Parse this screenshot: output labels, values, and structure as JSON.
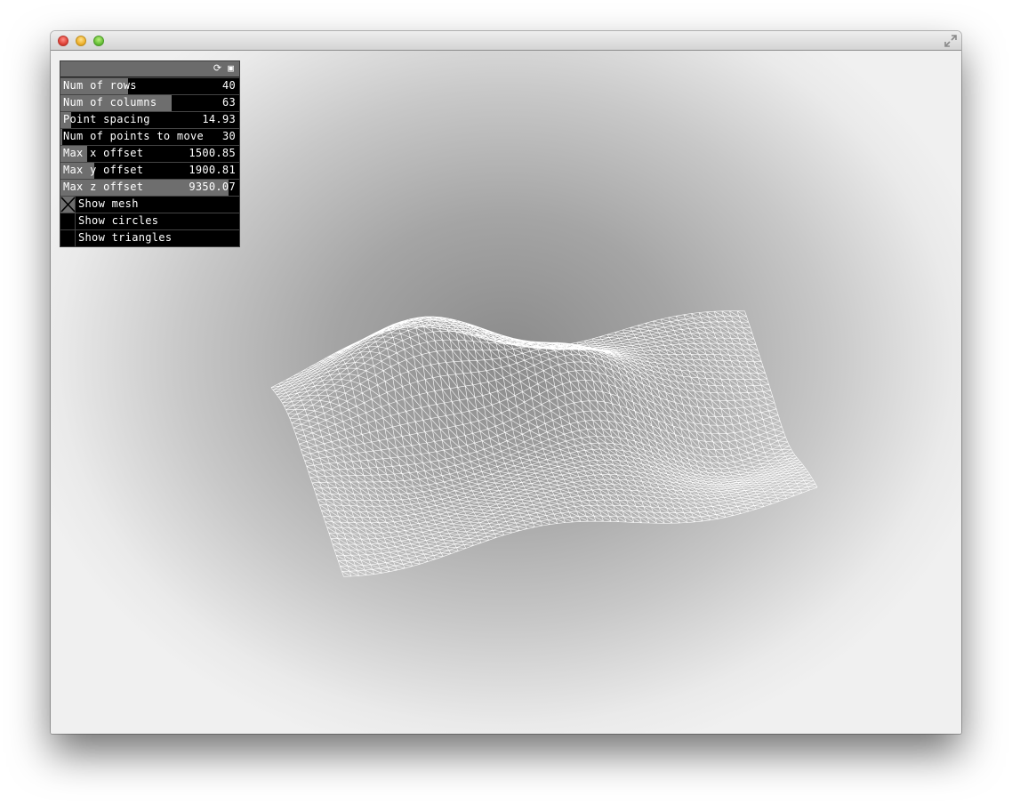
{
  "window": {
    "controls": [
      "close-icon",
      "minimize-icon",
      "zoom-icon",
      "fullscreen-icon"
    ]
  },
  "gui": {
    "header_icons": [
      "reload-icon",
      "save-icon"
    ],
    "sliders": [
      {
        "label": "Num of rows",
        "value": "40",
        "fill": 0.38
      },
      {
        "label": "Num of columns",
        "value": "63",
        "fill": 0.62
      },
      {
        "label": "Point spacing",
        "value": "14.93",
        "fill": 0.06
      },
      {
        "label": "Num of points to move",
        "value": "30",
        "fill": 0.01
      },
      {
        "label": "Max x offset",
        "value": "1500.85",
        "fill": 0.15
      },
      {
        "label": "Max y offset",
        "value": "1900.81",
        "fill": 0.19
      },
      {
        "label": "Max z offset",
        "value": "9350.07",
        "fill": 0.94
      }
    ],
    "toggles": [
      {
        "label": "Show mesh",
        "checked": true
      },
      {
        "label": "Show circles",
        "checked": false
      },
      {
        "label": "Show triangles",
        "checked": false
      }
    ]
  },
  "colors": {
    "mesh": "#ffffff",
    "panel_bg": "#000000",
    "slider_fill": "#6e6e6e",
    "header": "#6b6b6b"
  }
}
